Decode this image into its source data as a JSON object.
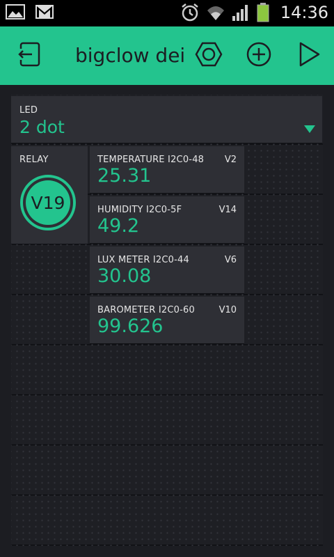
{
  "status_bar": {
    "time": "14:36",
    "icons": [
      "gallery-icon",
      "gmail-icon",
      "alarm-icon",
      "wifi-icon",
      "signal-icon",
      "battery-icon"
    ],
    "battery_color": "#8cc63f"
  },
  "app_bar": {
    "title": "bigclow dei",
    "background": "#23c48e",
    "buttons": [
      "exit-icon",
      "settings-hex-icon",
      "add-widget-icon",
      "play-icon"
    ]
  },
  "widgets": {
    "led": {
      "label": "LED",
      "value": "2 dot"
    },
    "relay": {
      "label": "RELAY",
      "pin": "V19"
    },
    "displays": [
      {
        "label": "TEMPERATURE I2C0-48",
        "pin": "V2",
        "value": "25.31"
      },
      {
        "label": "HUMIDITY I2C0-5F",
        "pin": "V14",
        "value": "49.2"
      },
      {
        "label": "LUX METER I2C0-44",
        "pin": "V6",
        "value": "30.08"
      },
      {
        "label": "BAROMETER I2C0-60",
        "pin": "V10",
        "value": "99.626"
      }
    ]
  },
  "colors": {
    "accent": "#23c48e",
    "widget_bg": "#2e2f35",
    "canvas_bg": "#1c1d22"
  }
}
